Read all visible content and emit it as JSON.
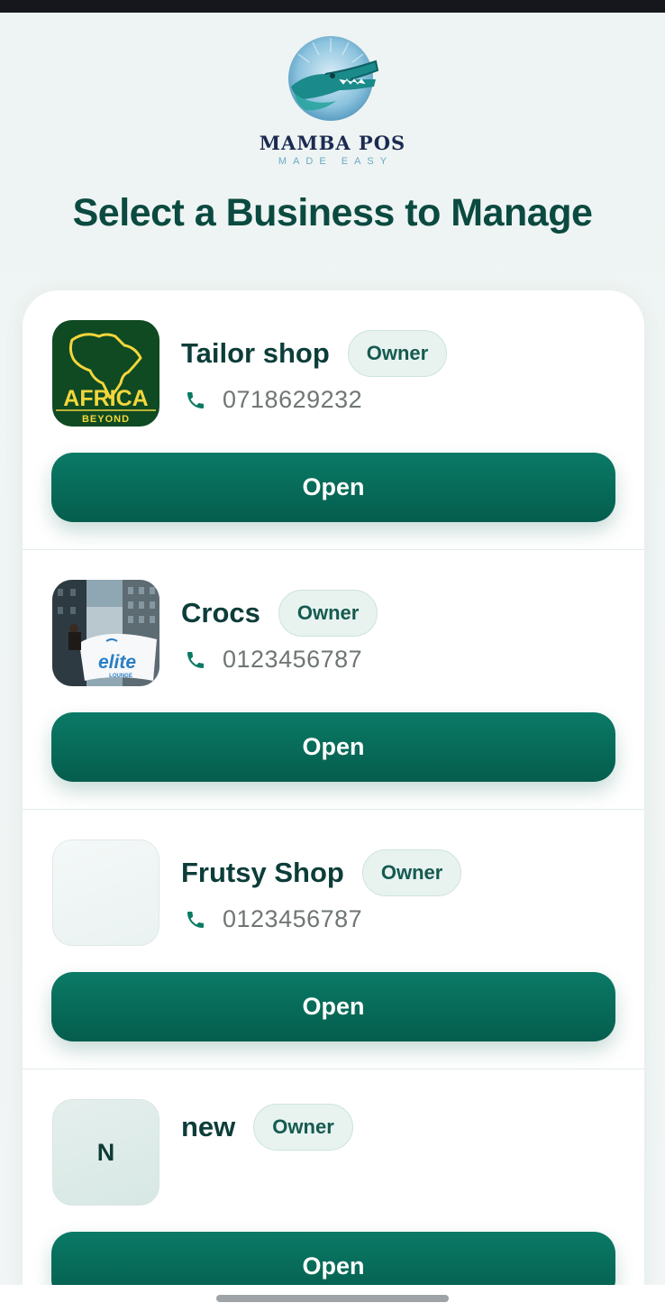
{
  "status_bar": {},
  "brand": {
    "name": "MAMBA POS",
    "tagline": "MADE EASY",
    "logo_icon": "crocodile-logo-icon",
    "colors": {
      "navy": "#1c2a52",
      "teal": "#6aa9c7"
    }
  },
  "page": {
    "title": "Select a Business to Manage"
  },
  "colors": {
    "primary": "#0a7a66",
    "primary_dark": "#055d4d",
    "title": "#0b4a40",
    "pill_bg": "#e8f3f0"
  },
  "businesses": [
    {
      "name": "Tailor shop",
      "role": "Owner",
      "phone": "0718629232",
      "open_label": "Open",
      "logo_text_main": "AFRICA",
      "logo_text_sub": "BEYOND"
    },
    {
      "name": "Crocs",
      "role": "Owner",
      "phone": "0123456787",
      "open_label": "Open",
      "logo_text_main": "elite",
      "logo_text_sub": "LOUNGE"
    },
    {
      "name": "Frutsy Shop",
      "role": "Owner",
      "phone": "0123456787",
      "open_label": "Open"
    },
    {
      "name": "new",
      "role": "Owner",
      "open_label": "Open",
      "initial": "N"
    }
  ],
  "icons": {
    "phone": "phone-icon"
  }
}
